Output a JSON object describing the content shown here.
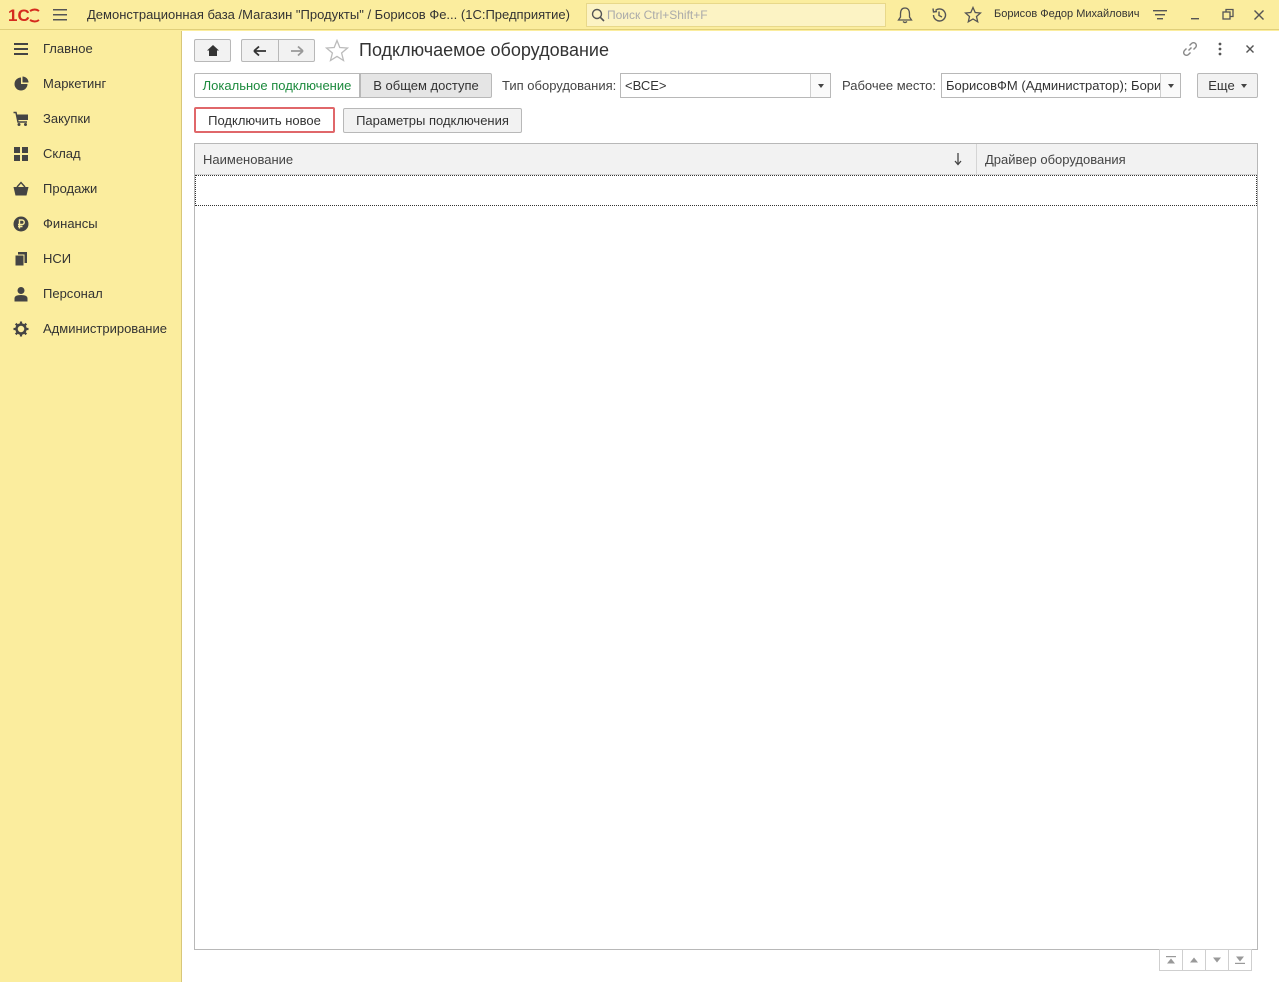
{
  "app": {
    "title": "Демонстрационная база /Магазин \"Продукты\" / Борисов Фе...  (1С:Предприятие)",
    "search_placeholder": "Поиск Ctrl+Shift+F",
    "user_name": "Борисов Федор Михайлович",
    "logo_text": "1С"
  },
  "sidebar": {
    "items": [
      {
        "label": "Главное",
        "icon": "list-icon"
      },
      {
        "label": "Маркетинг",
        "icon": "pie-chart-icon"
      },
      {
        "label": "Закупки",
        "icon": "cart-icon"
      },
      {
        "label": "Склад",
        "icon": "grid-icon"
      },
      {
        "label": "Продажи",
        "icon": "basket-icon"
      },
      {
        "label": "Финансы",
        "icon": "ruble-icon"
      },
      {
        "label": "НСИ",
        "icon": "books-icon"
      },
      {
        "label": "Персонал",
        "icon": "person-icon"
      },
      {
        "label": "Администрирование",
        "icon": "gear-icon"
      }
    ]
  },
  "form": {
    "title": "Подключаемое оборудование",
    "tab_local": "Локальное подключение",
    "tab_shared": "В общем доступе",
    "equipment_type_label": "Тип оборудования:",
    "equipment_type_value": "<ВСЕ>",
    "workplace_label": "Рабочее место:",
    "workplace_value": "БорисовФМ (Администратор); Борисов",
    "more_label": "Еще",
    "connect_new_label": "Подключить новое",
    "connection_params_label": "Параметры подключения"
  },
  "table": {
    "columns": [
      "Наименование",
      "Драйвер оборудования"
    ],
    "rows": []
  },
  "colors": {
    "sidebar_bg": "#fbed9e",
    "accent_green": "#1c8a3d",
    "highlight_red": "#e0676a"
  }
}
